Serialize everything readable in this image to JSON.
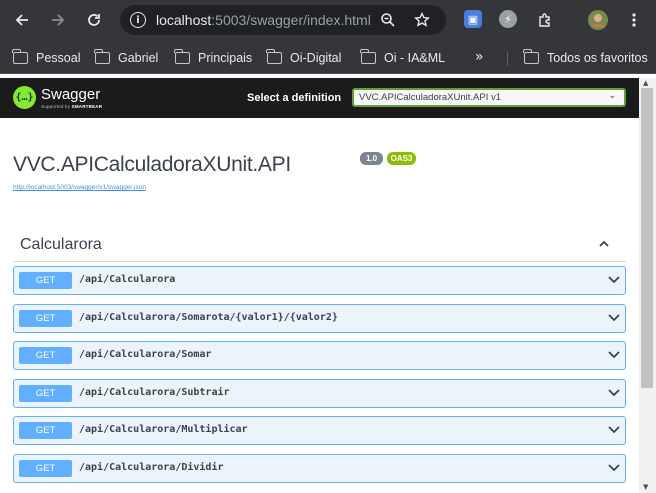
{
  "browser": {
    "url_host": "localhost",
    "url_rest": ":5003/swagger/index.html",
    "bookmarks": [
      {
        "label": "Pessoal"
      },
      {
        "label": "Gabriel"
      },
      {
        "label": "Principais"
      },
      {
        "label": "Oi-Digital"
      },
      {
        "label": "Oi - IA&ML"
      }
    ],
    "all_bookmarks_label": "Todos os favoritos",
    "icons": [
      "back-icon",
      "forward-icon",
      "reload-icon",
      "site-info-icon",
      "zoom-icon",
      "star-icon",
      "extension-icon",
      "profile-icon",
      "menu-icon"
    ]
  },
  "swagger": {
    "brand": "Swagger",
    "brand_sub_prefix": "Supported by ",
    "brand_sub_company": "SMARTBEAR",
    "select_label": "Select a definition",
    "selected_definition": "VVC.APICalculadoraXUnit.API v1",
    "api_title": "VVC.APICalculadoraXUnit.API",
    "version": "1.0",
    "oas": "OAS3",
    "spec_url": "http://localhost:5003/swagger/v1/swagger.json",
    "tag": "Calcularora",
    "operations": [
      {
        "method": "GET",
        "path": "/api/Calcularora"
      },
      {
        "method": "GET",
        "path": "/api/Calcularora/Somarota/{valor1}/{valor2}"
      },
      {
        "method": "GET",
        "path": "/api/Calcularora/Somar"
      },
      {
        "method": "GET",
        "path": "/api/Calcularora/Subtrair"
      },
      {
        "method": "GET",
        "path": "/api/Calcularora/Multiplicar"
      },
      {
        "method": "GET",
        "path": "/api/Calcularora/Dividir"
      }
    ],
    "colors": {
      "get": "#61affe",
      "get_bg": "#ebf3fb",
      "topbar": "#1b1b1b",
      "logo": "#85ea2d",
      "oas": "#89bf04"
    }
  }
}
